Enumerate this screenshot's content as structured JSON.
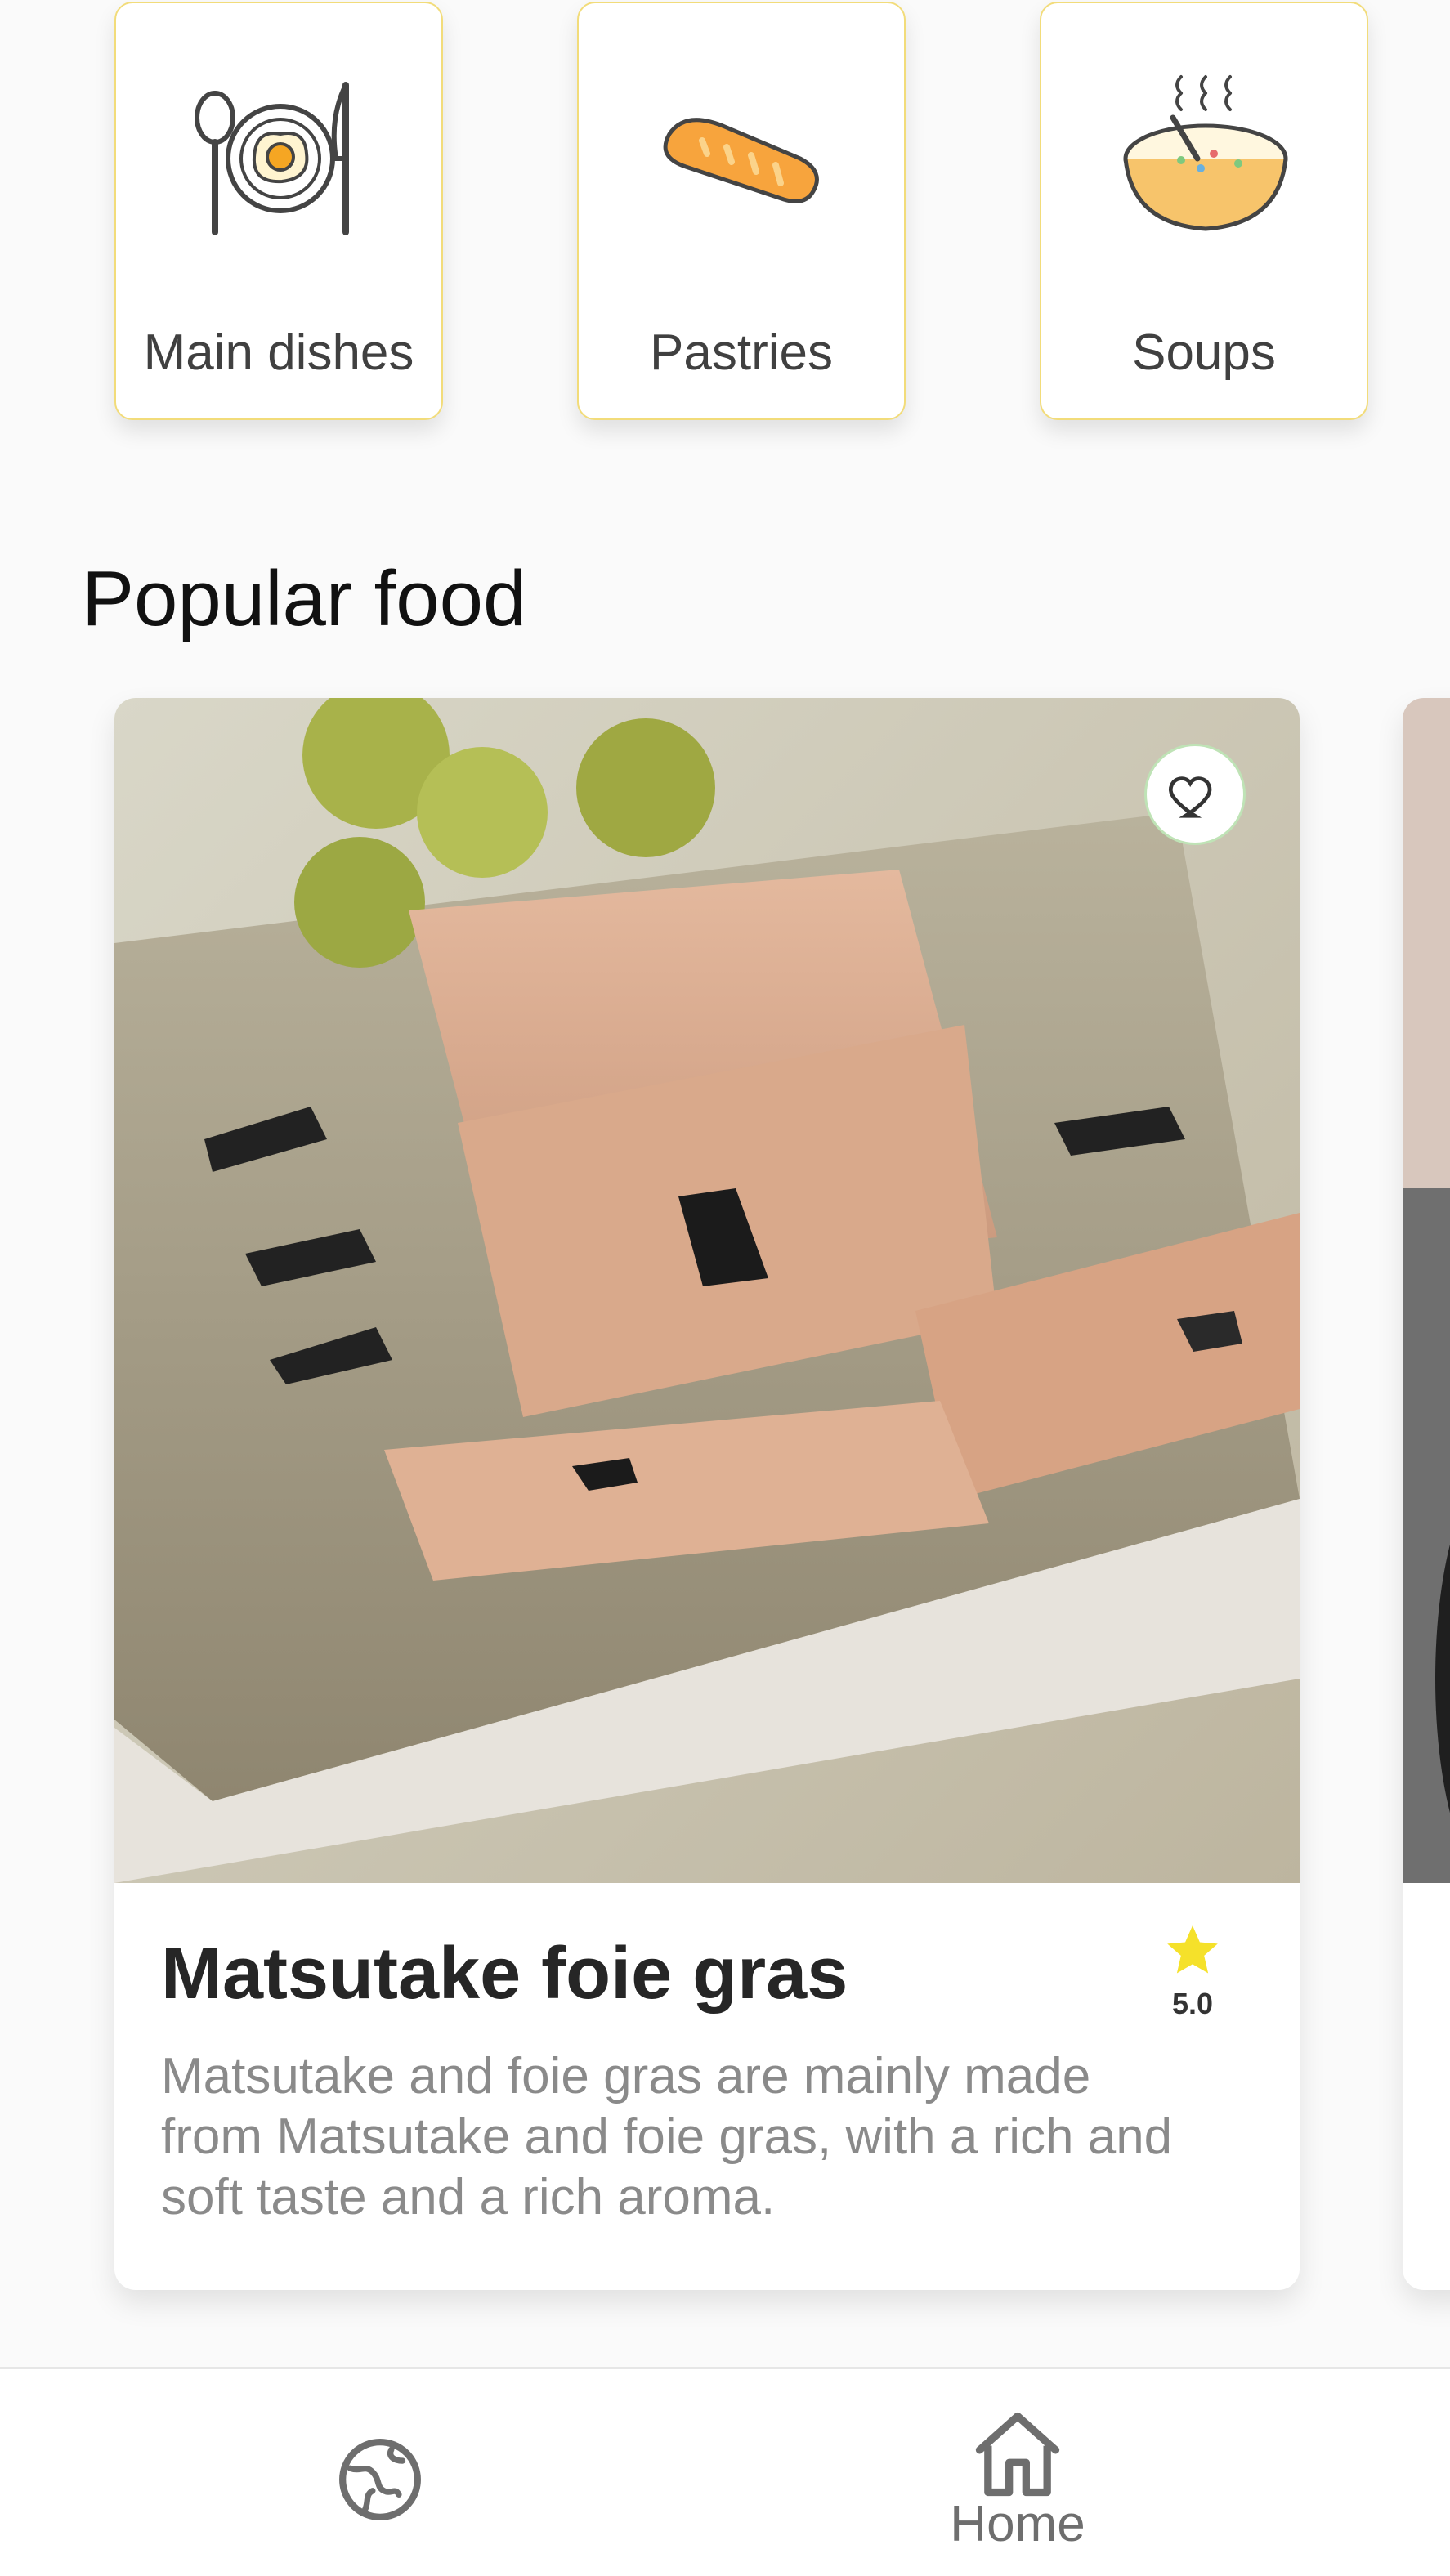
{
  "categories": [
    {
      "label": "Main dishes",
      "icon": "plate-icon"
    },
    {
      "label": "Pastries",
      "icon": "bread-icon"
    },
    {
      "label": "Soups",
      "icon": "soup-bowl-icon"
    }
  ],
  "popular": {
    "title": "Popular food",
    "items": [
      {
        "name": "Matsutake foie gras",
        "rating": "5.0",
        "description": "Matsutake and foie gras are mainly made from Matsutake and foie gras, with a rich and soft taste and a rich aroma.",
        "favorite_icon": "heart-outline-icon",
        "rating_icon": "star-icon"
      }
    ]
  },
  "bottom_nav": {
    "items": [
      {
        "icon": "globe-icon",
        "label": ""
      },
      {
        "icon": "home-icon",
        "label": "Home"
      }
    ]
  },
  "colors": {
    "card_border": "#f2dc7a",
    "star": "#f5e12a",
    "text_dark": "#262626",
    "text_muted": "#8a8a8a",
    "background": "#fafafa"
  }
}
